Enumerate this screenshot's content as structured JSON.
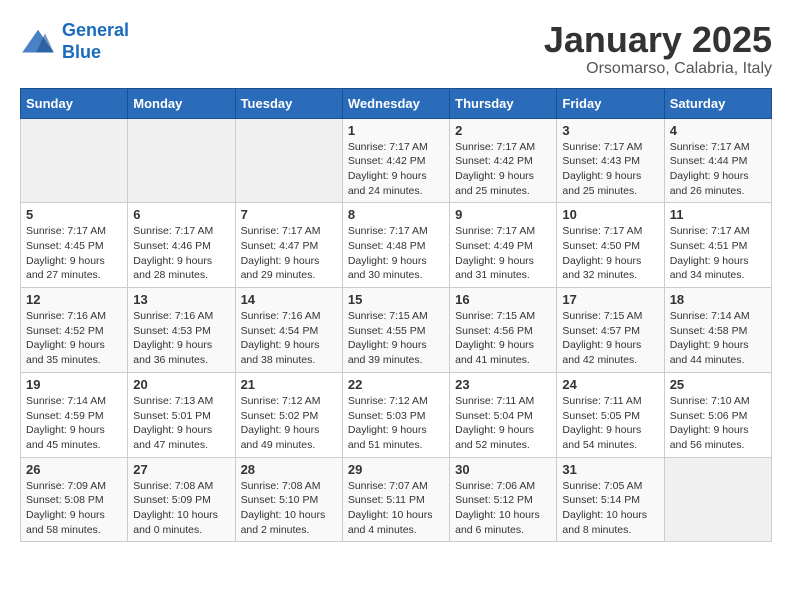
{
  "logo": {
    "line1": "General",
    "line2": "Blue"
  },
  "title": "January 2025",
  "location": "Orsomarso, Calabria, Italy",
  "weekdays": [
    "Sunday",
    "Monday",
    "Tuesday",
    "Wednesday",
    "Thursday",
    "Friday",
    "Saturday"
  ],
  "weeks": [
    [
      {
        "day": "",
        "info": ""
      },
      {
        "day": "",
        "info": ""
      },
      {
        "day": "",
        "info": ""
      },
      {
        "day": "1",
        "info": "Sunrise: 7:17 AM\nSunset: 4:42 PM\nDaylight: 9 hours\nand 24 minutes."
      },
      {
        "day": "2",
        "info": "Sunrise: 7:17 AM\nSunset: 4:42 PM\nDaylight: 9 hours\nand 25 minutes."
      },
      {
        "day": "3",
        "info": "Sunrise: 7:17 AM\nSunset: 4:43 PM\nDaylight: 9 hours\nand 25 minutes."
      },
      {
        "day": "4",
        "info": "Sunrise: 7:17 AM\nSunset: 4:44 PM\nDaylight: 9 hours\nand 26 minutes."
      }
    ],
    [
      {
        "day": "5",
        "info": "Sunrise: 7:17 AM\nSunset: 4:45 PM\nDaylight: 9 hours\nand 27 minutes."
      },
      {
        "day": "6",
        "info": "Sunrise: 7:17 AM\nSunset: 4:46 PM\nDaylight: 9 hours\nand 28 minutes."
      },
      {
        "day": "7",
        "info": "Sunrise: 7:17 AM\nSunset: 4:47 PM\nDaylight: 9 hours\nand 29 minutes."
      },
      {
        "day": "8",
        "info": "Sunrise: 7:17 AM\nSunset: 4:48 PM\nDaylight: 9 hours\nand 30 minutes."
      },
      {
        "day": "9",
        "info": "Sunrise: 7:17 AM\nSunset: 4:49 PM\nDaylight: 9 hours\nand 31 minutes."
      },
      {
        "day": "10",
        "info": "Sunrise: 7:17 AM\nSunset: 4:50 PM\nDaylight: 9 hours\nand 32 minutes."
      },
      {
        "day": "11",
        "info": "Sunrise: 7:17 AM\nSunset: 4:51 PM\nDaylight: 9 hours\nand 34 minutes."
      }
    ],
    [
      {
        "day": "12",
        "info": "Sunrise: 7:16 AM\nSunset: 4:52 PM\nDaylight: 9 hours\nand 35 minutes."
      },
      {
        "day": "13",
        "info": "Sunrise: 7:16 AM\nSunset: 4:53 PM\nDaylight: 9 hours\nand 36 minutes."
      },
      {
        "day": "14",
        "info": "Sunrise: 7:16 AM\nSunset: 4:54 PM\nDaylight: 9 hours\nand 38 minutes."
      },
      {
        "day": "15",
        "info": "Sunrise: 7:15 AM\nSunset: 4:55 PM\nDaylight: 9 hours\nand 39 minutes."
      },
      {
        "day": "16",
        "info": "Sunrise: 7:15 AM\nSunset: 4:56 PM\nDaylight: 9 hours\nand 41 minutes."
      },
      {
        "day": "17",
        "info": "Sunrise: 7:15 AM\nSunset: 4:57 PM\nDaylight: 9 hours\nand 42 minutes."
      },
      {
        "day": "18",
        "info": "Sunrise: 7:14 AM\nSunset: 4:58 PM\nDaylight: 9 hours\nand 44 minutes."
      }
    ],
    [
      {
        "day": "19",
        "info": "Sunrise: 7:14 AM\nSunset: 4:59 PM\nDaylight: 9 hours\nand 45 minutes."
      },
      {
        "day": "20",
        "info": "Sunrise: 7:13 AM\nSunset: 5:01 PM\nDaylight: 9 hours\nand 47 minutes."
      },
      {
        "day": "21",
        "info": "Sunrise: 7:12 AM\nSunset: 5:02 PM\nDaylight: 9 hours\nand 49 minutes."
      },
      {
        "day": "22",
        "info": "Sunrise: 7:12 AM\nSunset: 5:03 PM\nDaylight: 9 hours\nand 51 minutes."
      },
      {
        "day": "23",
        "info": "Sunrise: 7:11 AM\nSunset: 5:04 PM\nDaylight: 9 hours\nand 52 minutes."
      },
      {
        "day": "24",
        "info": "Sunrise: 7:11 AM\nSunset: 5:05 PM\nDaylight: 9 hours\nand 54 minutes."
      },
      {
        "day": "25",
        "info": "Sunrise: 7:10 AM\nSunset: 5:06 PM\nDaylight: 9 hours\nand 56 minutes."
      }
    ],
    [
      {
        "day": "26",
        "info": "Sunrise: 7:09 AM\nSunset: 5:08 PM\nDaylight: 9 hours\nand 58 minutes."
      },
      {
        "day": "27",
        "info": "Sunrise: 7:08 AM\nSunset: 5:09 PM\nDaylight: 10 hours\nand 0 minutes."
      },
      {
        "day": "28",
        "info": "Sunrise: 7:08 AM\nSunset: 5:10 PM\nDaylight: 10 hours\nand 2 minutes."
      },
      {
        "day": "29",
        "info": "Sunrise: 7:07 AM\nSunset: 5:11 PM\nDaylight: 10 hours\nand 4 minutes."
      },
      {
        "day": "30",
        "info": "Sunrise: 7:06 AM\nSunset: 5:12 PM\nDaylight: 10 hours\nand 6 minutes."
      },
      {
        "day": "31",
        "info": "Sunrise: 7:05 AM\nSunset: 5:14 PM\nDaylight: 10 hours\nand 8 minutes."
      },
      {
        "day": "",
        "info": ""
      }
    ]
  ]
}
